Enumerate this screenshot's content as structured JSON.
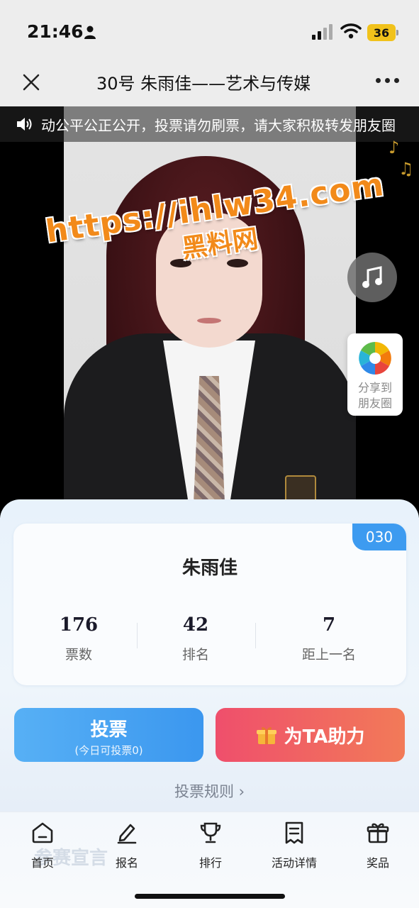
{
  "status_bar": {
    "time": "21:46",
    "battery": "36"
  },
  "nav": {
    "title": "30号 朱雨佳——艺术与传媒"
  },
  "ticker": {
    "text": "动公平公正公开，投票请勿刷票，请大家积极转发朋友圈"
  },
  "watermark": {
    "url": "https://ihlw34.com",
    "sub": "黑料网"
  },
  "share": {
    "label_line1": "分享到",
    "label_line2": "朋友圈"
  },
  "contestant": {
    "number": "030",
    "name": "朱雨佳",
    "stats": [
      {
        "value": "176",
        "label": "票数"
      },
      {
        "value": "42",
        "label": "排名"
      },
      {
        "value": "7",
        "label": "距上一名"
      }
    ]
  },
  "actions": {
    "vote_label": "投票",
    "vote_sub": "(今日可投票0)",
    "boost_label": "为TA助力",
    "rules_link": "投票规则 ›"
  },
  "bottom_nav": {
    "faded_text": "参赛宣言",
    "items": [
      {
        "label": "首页",
        "icon": "home-icon"
      },
      {
        "label": "报名",
        "icon": "edit-icon"
      },
      {
        "label": "排行",
        "icon": "trophy-icon"
      },
      {
        "label": "活动详情",
        "icon": "document-icon"
      },
      {
        "label": "奖品",
        "icon": "gift-icon"
      }
    ]
  },
  "colors": {
    "accent_blue": "#3d9bf0",
    "accent_red": "#ef4f6c",
    "watermark_orange": "#f28a1a"
  }
}
